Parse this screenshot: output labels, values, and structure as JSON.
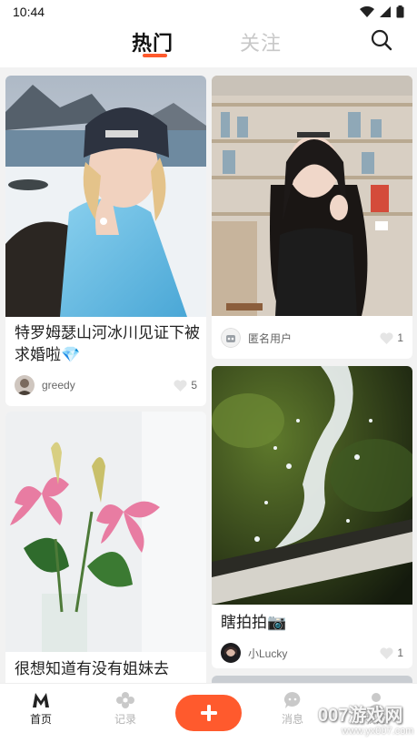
{
  "status_bar": {
    "time": "10:44"
  },
  "header": {
    "tab_hot": "热门",
    "tab_follow": "关注",
    "active_tab": "热门",
    "accent_color": "#ff5a2d"
  },
  "feed": {
    "cards": [
      {
        "title": "特罗姆瑟山河冰川见证下被求婚啦💎",
        "author": "greedy",
        "likes": "5"
      },
      {
        "title": "",
        "author": "匿名用户",
        "likes": "1"
      },
      {
        "title": "瞎拍拍📷",
        "author": "小Lucky",
        "likes": "1"
      },
      {
        "title": "很想知道有没有姐妹去",
        "author": "",
        "likes": ""
      }
    ]
  },
  "bottom_nav": {
    "home": "首页",
    "record": "记录",
    "messages": "消息",
    "profile": "我的",
    "add_icon": "plus-icon"
  },
  "watermark": {
    "brand": "007游戏网",
    "url": "www.yx007.com"
  }
}
